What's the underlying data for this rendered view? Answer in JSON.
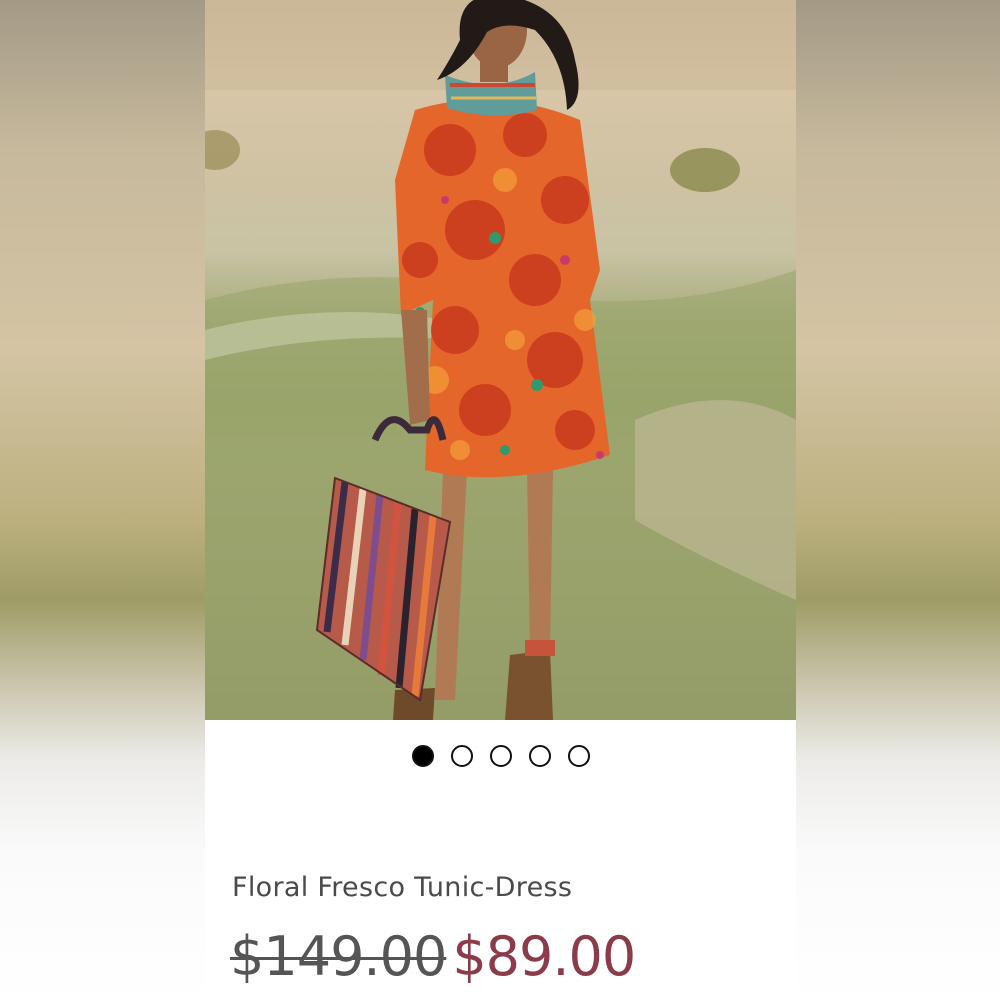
{
  "product": {
    "title": "Floral Fresco Tunic-Dress",
    "price_original": "$149.00",
    "price_sale": "$89.00"
  },
  "carousel": {
    "total_slides": 5,
    "active_index": 0
  },
  "colors": {
    "sale_price": "#8c3b4a",
    "title_text": "#4a4a4a",
    "dot_active": "#000000"
  }
}
